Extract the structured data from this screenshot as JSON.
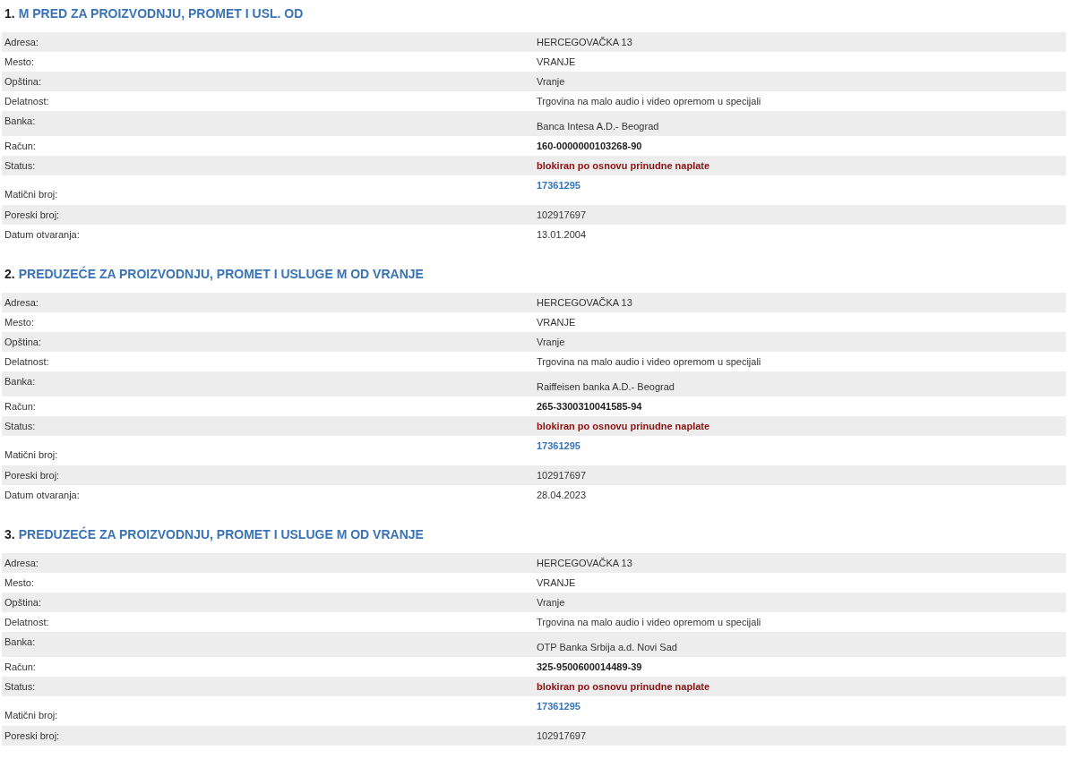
{
  "companies": [
    {
      "number": "1.",
      "name": "M PRED ZA PROIZVODNJU, PROMET I USL. OD",
      "rows": [
        {
          "label": "Adresa:",
          "value": "HERCEGOVAČKA 13",
          "kind": "text"
        },
        {
          "label": "Mesto:",
          "value": "VRANJE",
          "kind": "text"
        },
        {
          "label": "Opština:",
          "value": "Vranje",
          "kind": "text"
        },
        {
          "label": "Delatnost:",
          "value": "Trgovina na malo audio i video opremom u specijali",
          "kind": "text"
        },
        {
          "label": "Banka:",
          "value": "Banca Intesa A.D.- Beograd",
          "kind": "bank"
        },
        {
          "label": "Račun:",
          "value": "160-0000000103268-90",
          "kind": "bold"
        },
        {
          "label": "Status:",
          "value": "blokiran po osnovu prinudne naplate",
          "kind": "status"
        },
        {
          "label": "Matični broj:",
          "value": "17361295",
          "kind": "link"
        },
        {
          "label": "Poreski broj:",
          "value": "102917697",
          "kind": "text"
        },
        {
          "label": "Datum otvaranja:",
          "value": "13.01.2004",
          "kind": "text"
        }
      ]
    },
    {
      "number": "2.",
      "name": "PREDUZEĆE ZA PROIZVODNJU, PROMET I USLUGE M OD VRANJE",
      "rows": [
        {
          "label": "Adresa:",
          "value": "HERCEGOVAČKA 13",
          "kind": "text"
        },
        {
          "label": "Mesto:",
          "value": "VRANJE",
          "kind": "text"
        },
        {
          "label": "Opština:",
          "value": "Vranje",
          "kind": "text"
        },
        {
          "label": "Delatnost:",
          "value": "Trgovina na malo audio i video opremom u specijali",
          "kind": "text"
        },
        {
          "label": "Banka:",
          "value": "Raiffeisen banka A.D.- Beograd",
          "kind": "bank"
        },
        {
          "label": "Račun:",
          "value": "265-3300310041585-94",
          "kind": "bold"
        },
        {
          "label": "Status:",
          "value": "blokiran po osnovu prinudne naplate",
          "kind": "status"
        },
        {
          "label": "Matični broj:",
          "value": "17361295",
          "kind": "link"
        },
        {
          "label": "Poreski broj:",
          "value": "102917697",
          "kind": "text"
        },
        {
          "label": "Datum otvaranja:",
          "value": "28.04.2023",
          "kind": "text"
        }
      ]
    },
    {
      "number": "3.",
      "name": "PREDUZEĆE ZA PROIZVODNJU, PROMET I USLUGE M OD VRANJE",
      "rows": [
        {
          "label": "Adresa:",
          "value": "HERCEGOVAČKA 13",
          "kind": "text"
        },
        {
          "label": "Mesto:",
          "value": "VRANJE",
          "kind": "text"
        },
        {
          "label": "Opština:",
          "value": "Vranje",
          "kind": "text"
        },
        {
          "label": "Delatnost:",
          "value": "Trgovina na malo audio i video opremom u specijali",
          "kind": "text"
        },
        {
          "label": "Banka:",
          "value": "OTP Banka Srbija a.d. Novi Sad",
          "kind": "bank"
        },
        {
          "label": "Račun:",
          "value": "325-9500600014489-39",
          "kind": "bold"
        },
        {
          "label": "Status:",
          "value": "blokiran po osnovu prinudne naplate",
          "kind": "status"
        },
        {
          "label": "Matični broj:",
          "value": "17361295",
          "kind": "link"
        },
        {
          "label": "Poreski broj:",
          "value": "102917697",
          "kind": "text"
        }
      ]
    }
  ]
}
